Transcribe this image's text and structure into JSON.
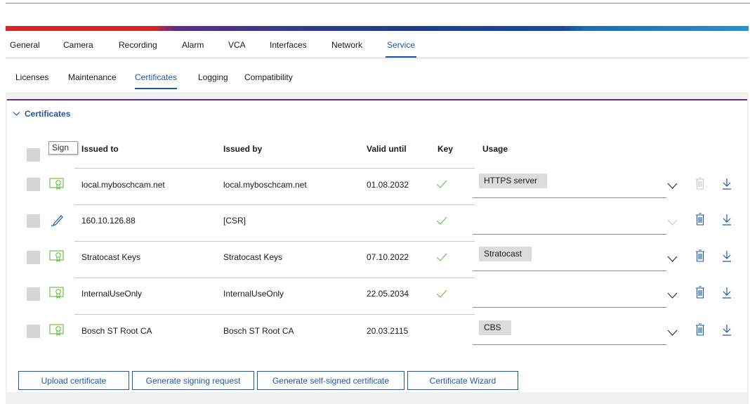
{
  "main_tabs": [
    {
      "label": "General"
    },
    {
      "label": "Camera"
    },
    {
      "label": "Recording"
    },
    {
      "label": "Alarm"
    },
    {
      "label": "VCA"
    },
    {
      "label": "Interfaces"
    },
    {
      "label": "Network"
    },
    {
      "label": "Service",
      "active": true
    }
  ],
  "sub_tabs": [
    {
      "label": "Licenses"
    },
    {
      "label": "Maintenance"
    },
    {
      "label": "Certificates",
      "active": true
    },
    {
      "label": "Logging"
    },
    {
      "label": "Compatibility"
    }
  ],
  "section": {
    "title": "Certificates",
    "expanded": true
  },
  "table": {
    "columns": {
      "issued_to": "Issued to",
      "issued_by": "Issued by",
      "valid_until": "Valid until",
      "key": "Key",
      "usage": "Usage"
    },
    "rows": [
      {
        "icon": "certificate-icon",
        "issued_to": "local.myboschcam.net",
        "issued_by": "local.myboschcam.net",
        "valid_until": "01.08.2032",
        "key": true,
        "usage": "HTTPS server",
        "delete_enabled": false
      },
      {
        "icon": "pencil-icon",
        "issued_to": "160.10.126.88",
        "issued_by": "[CSR]",
        "valid_until": "",
        "key": true,
        "usage": "",
        "dropdown_enabled": false,
        "delete_enabled": true
      },
      {
        "icon": "certificate-icon",
        "issued_to": "Stratocast Keys",
        "issued_by": "Stratocast Keys",
        "valid_until": "07.10.2022",
        "key": true,
        "usage": "Stratocast",
        "delete_enabled": true
      },
      {
        "icon": "certificate-icon",
        "issued_to": "InternalUseOnly",
        "issued_by": "InternalUseOnly",
        "valid_until": "22.05.2034",
        "key": true,
        "usage": "",
        "delete_enabled": true
      },
      {
        "icon": "certificate-icon",
        "issued_to": "Bosch ST Root CA",
        "issued_by": "Bosch ST Root CA",
        "valid_until": "20.03.2115",
        "key": false,
        "usage": "CBS",
        "delete_enabled": true
      }
    ]
  },
  "tooltip": {
    "text": "Sign"
  },
  "buttons": {
    "upload": "Upload certificate",
    "signing_request": "Generate signing request",
    "self_signed": "Generate self-signed certificate",
    "wizard": "Certificate Wizard"
  },
  "colors": {
    "accent": "#1d5aa6",
    "check": "#6cc04a",
    "separator_purple": "#5a2d89",
    "brand_red": "#d8232a"
  }
}
